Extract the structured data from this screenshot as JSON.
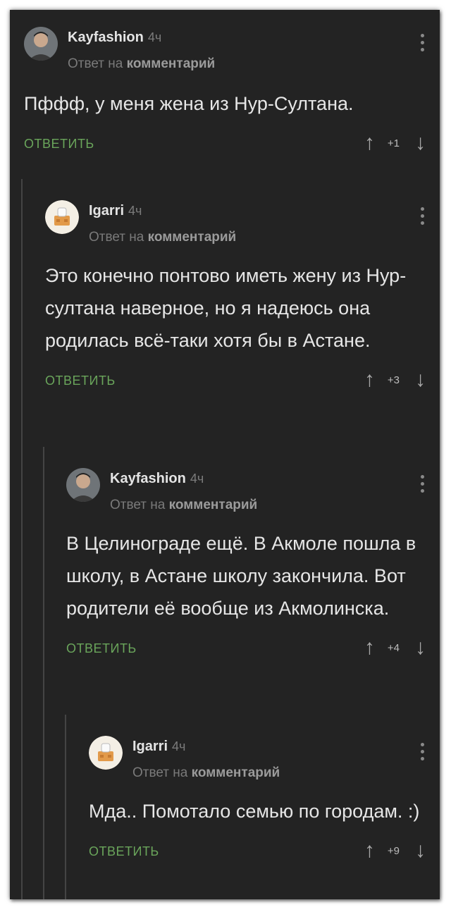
{
  "comments": [
    {
      "author": "Kayfashion",
      "time": "4ч",
      "reply_prefix": "Ответ на",
      "reply_target": "комментарий",
      "text": "Пффф, у меня жена из Нур-Султана.",
      "reply_label": "ОТВЕТИТЬ",
      "score": "+1"
    },
    {
      "author": "Igarri",
      "time": "4ч",
      "reply_prefix": "Ответ на",
      "reply_target": "комментарий",
      "text": "Это конечно понтово иметь жену из Нур-султана наверное, но я надеюсь она родилась всё-таки хотя бы в Астане.",
      "reply_label": "ОТВЕТИТЬ",
      "score": "+3"
    },
    {
      "author": "Kayfashion",
      "time": "4ч",
      "reply_prefix": "Ответ на",
      "reply_target": "комментарий",
      "text": "В Целинограде ещё. В Акмоле пошла в школу, в Астане школу закончила. Вот родители её вообще из Акмолинска.",
      "reply_label": "ОТВЕТИТЬ",
      "score": "+4"
    },
    {
      "author": "Igarri",
      "time": "4ч",
      "reply_prefix": "Ответ на",
      "reply_target": "комментарий",
      "text": "Мда.. Помотало семью по городам. :)",
      "reply_label": "ОТВЕТИТЬ",
      "score": "+9"
    }
  ],
  "icons": {
    "upvote": "arrow-up-icon",
    "downvote": "arrow-down-icon",
    "menu": "more-vertical-icon"
  },
  "colors": {
    "background": "#232323",
    "reply_button": "#6aa55b",
    "text": "#e6e6e6"
  }
}
